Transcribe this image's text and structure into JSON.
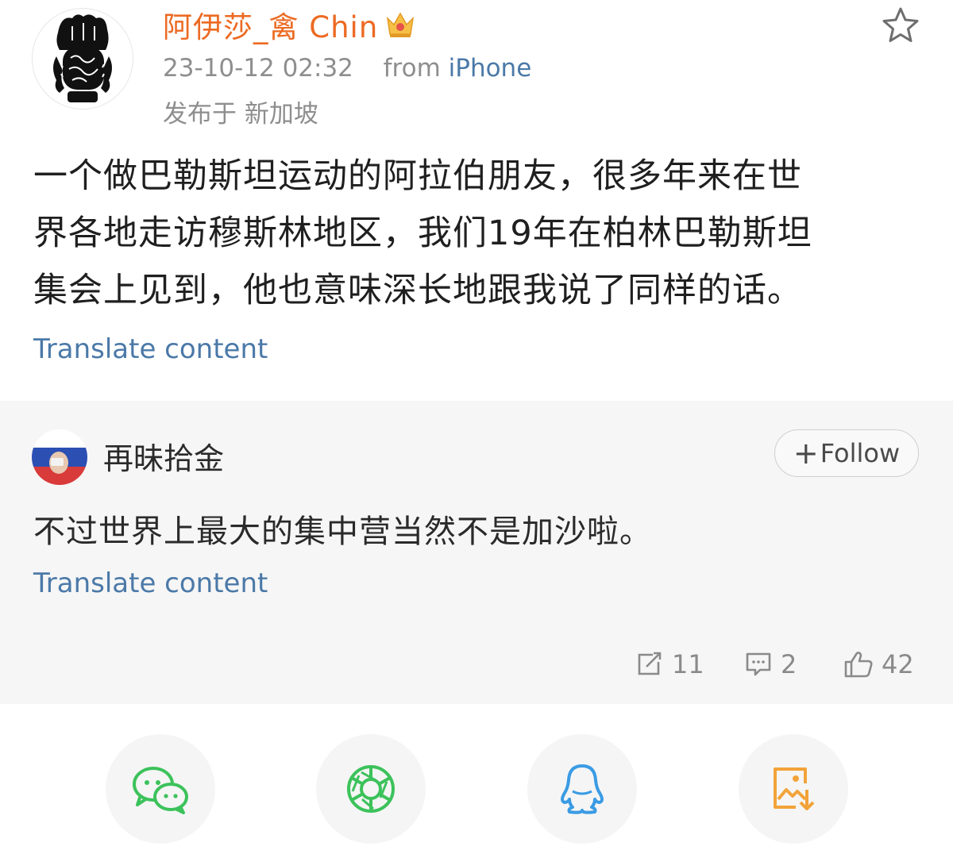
{
  "post": {
    "author": "阿伊莎_禽 Chin",
    "timestamp": "23-10-12 02:32",
    "from_prefix": "from",
    "source": "iPhone",
    "location": "发布于 新加坡",
    "text_line1": "一个做巴勒斯坦运动的阿拉伯朋友，很多年来在世",
    "text_line2": "界各地走访穆斯林地区，我们19年在柏林巴勒斯坦",
    "text_line3": "集会上见到，他也意味深长地跟我说了同样的话。",
    "translate_label": "Translate content"
  },
  "comment": {
    "author": "再昧拾金",
    "follow_label": "Follow",
    "text": "不过世界上最大的集中营当然不是加沙啦。",
    "translate_label": "Translate content"
  },
  "stats": {
    "reposts": "11",
    "comments": "2",
    "likes": "42"
  },
  "share": {
    "icons": [
      "wechat-icon",
      "moments-icon",
      "qq-icon",
      "save-image-icon"
    ]
  },
  "colors": {
    "author_name": "#ec6a22",
    "link": "#4b79a8",
    "meta_grey": "#8e8e8e",
    "wechat_green": "#3cc25b",
    "qq_blue": "#3a9be4",
    "save_orange": "#f2a33a"
  }
}
